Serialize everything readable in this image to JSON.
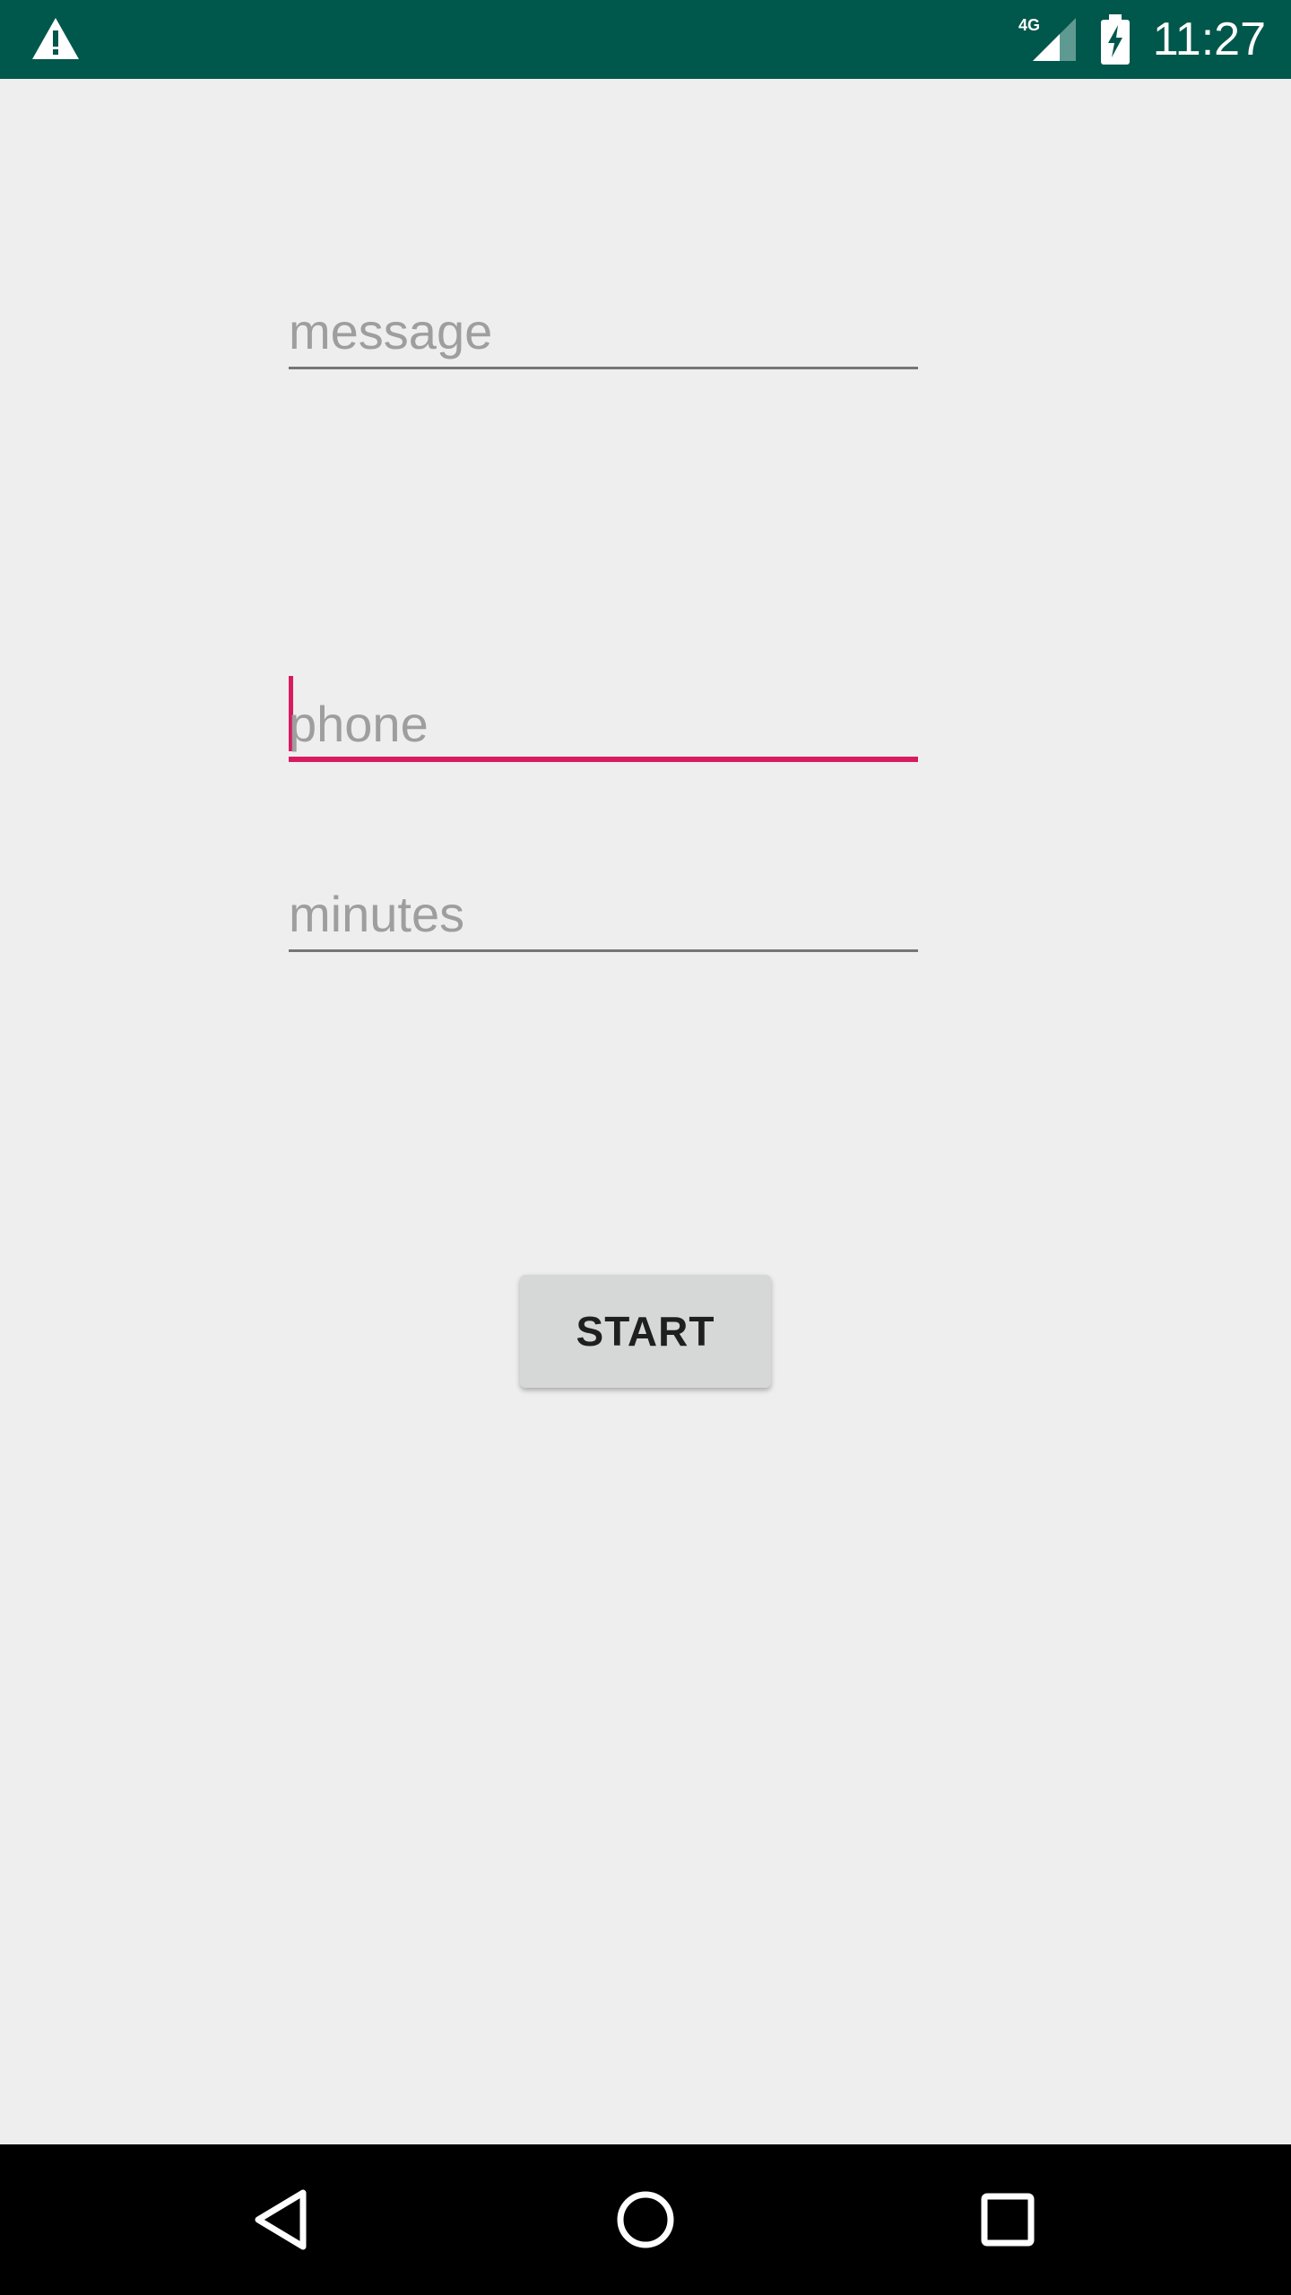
{
  "status_bar": {
    "time": "11:27",
    "network": "4G",
    "icons": [
      "warning-icon",
      "signal-4g-icon",
      "battery-charging-icon"
    ],
    "background_color": "#00574b"
  },
  "form": {
    "message_placeholder": "message",
    "phone_placeholder": "phone",
    "minutes_placeholder": "minutes",
    "focused_field": "phone",
    "accent_color": "#d81b60"
  },
  "start_button": {
    "label": "START"
  },
  "nav_bar": {
    "icons": [
      "back-icon",
      "home-icon",
      "recents-icon"
    ]
  }
}
